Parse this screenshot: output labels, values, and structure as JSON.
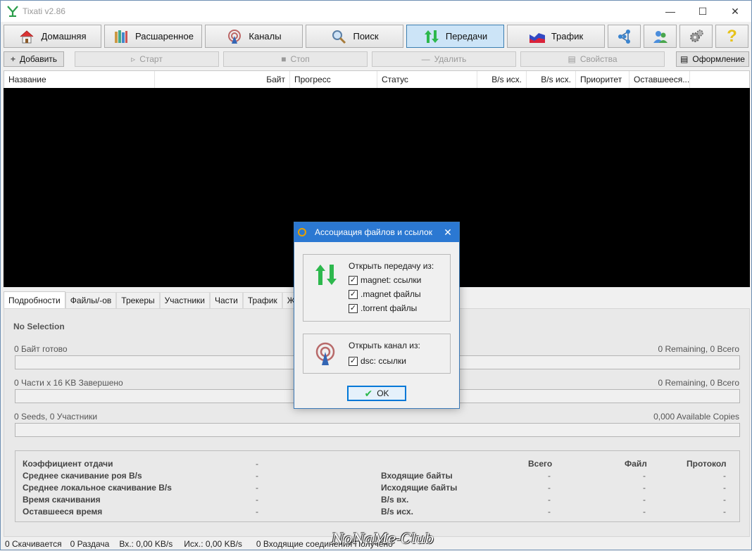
{
  "window": {
    "title": "Tixati v2.86"
  },
  "main_toolbar": {
    "home": "Домашняя",
    "shared": "Расшаренное",
    "channels": "Каналы",
    "search": "Поиск",
    "transfers": "Передачи",
    "traffic": "Трафик"
  },
  "sub_toolbar": {
    "add": "Добавить",
    "start": "Старт",
    "stop": "Стоп",
    "delete": "Удалить",
    "properties": "Свойства",
    "layout": "Оформление"
  },
  "list": {
    "columns": [
      "Название",
      "Байт",
      "Прогресс",
      "Статус",
      "B/s исх.",
      "B/s исх.",
      "Приоритет",
      "Оставшееся..."
    ]
  },
  "tabs": [
    "Подробности",
    "Файлы/-ов",
    "Трекеры",
    "Участники",
    "Части",
    "Трафик",
    "Ж"
  ],
  "details": {
    "selection": "No Selection",
    "bytes_ready": "0 Байт готово",
    "bytes_right": "0 Remaining,  0 Всего",
    "pieces": "0 Части  x  16 KB Завершено",
    "pieces_right": "0 Remaining,  0 Всего",
    "seeds": "0 Seeds, 0 Участники",
    "seeds_right": "0,000 Available Copies",
    "stats": {
      "ratio": "Коэффициент отдачи",
      "ratio_val": "-",
      "swarm_dl": "Среднее скачивание роя B/s",
      "swarm_dl_val": "-",
      "local_dl": "Среднее локальное скачивание B/s",
      "local_dl_val": "-",
      "dl_time": "Время скачивания",
      "dl_time_val": "-",
      "remaining": "Оставшееся время",
      "remaining_val": "-",
      "col_total": "Всего",
      "col_file": "Файл",
      "col_protocol": "Протокол",
      "in_bytes": "Входящие байты",
      "out_bytes": "Исходящие байты",
      "bs_in": "B/s вх.",
      "bs_out": "B/s исх.",
      "dash": "-"
    }
  },
  "statusbar": {
    "downloading": "0 Скачивается",
    "seeding": "0 Раздача",
    "in": "Вх.: 0,00 KB/s",
    "out": "Исх.: 0,00 KB/s",
    "incoming": "0 Входящие соединения Получено"
  },
  "watermark": "NoNaMe-Club",
  "dialog": {
    "title": "Ассоциация файлов и ссылок",
    "transfer_group": "Открыть передачу из:",
    "magnet_links": "magnet: ссылки",
    "magnet_files": ".magnet файлы",
    "torrent_files": ".torrent файлы",
    "channel_group": "Открыть канал из:",
    "dsc_links": "dsc: ссылки",
    "ok": "OK"
  },
  "colors": {
    "accent": "#2b78d2",
    "active_tab": "#cce4f7",
    "green_arrow": "#2db84d"
  }
}
